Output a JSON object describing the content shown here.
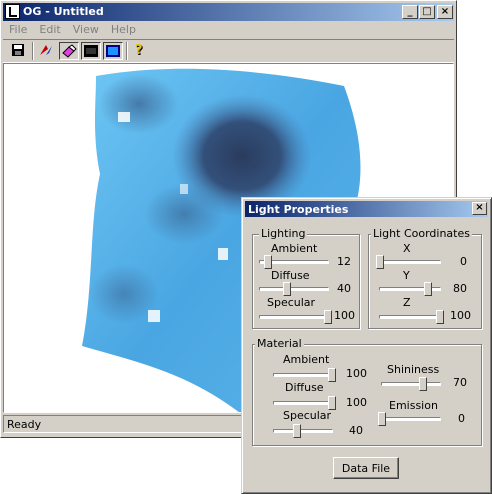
{
  "window": {
    "title": "OG - Untitled",
    "status": "Ready",
    "caption_buttons": {
      "minimize": "_",
      "maximize": "□",
      "close": "×"
    }
  },
  "menu": [
    "File",
    "Edit",
    "View",
    "Help"
  ],
  "toolbar": {
    "icons": [
      "save-icon",
      "light-icon",
      "eraser-icon",
      "black-rect-icon",
      "blue-rect-icon",
      "help-icon"
    ]
  },
  "colors": {
    "title_start": "#0a246a",
    "title_end": "#a6caf0",
    "surface_light": "#5ab4ea",
    "surface_dark": "#3d6a98",
    "surface_shadow": "#2a3c5e",
    "face": "#d4d0c8"
  },
  "dialog": {
    "title": "Light Properties",
    "close": "×",
    "lighting": {
      "label": "Lighting",
      "items": [
        {
          "label": "Ambient",
          "value": "12",
          "level": 0.12
        },
        {
          "label": "Diffuse",
          "value": "40",
          "level": 0.4
        },
        {
          "label": "Specular",
          "value": "100",
          "level": 1.0
        }
      ]
    },
    "coords": {
      "label": "Light Coordinates",
      "items": [
        {
          "label": "X",
          "value": "0",
          "level": 0.0
        },
        {
          "label": "Y",
          "value": "80",
          "level": 0.8
        },
        {
          "label": "Z",
          "value": "100",
          "level": 1.0
        }
      ]
    },
    "material": {
      "label": "Material",
      "left": [
        {
          "label": "Ambient",
          "value": "100",
          "level": 1.0
        },
        {
          "label": "Diffuse",
          "value": "100",
          "level": 1.0
        },
        {
          "label": "Specular",
          "value": "40",
          "level": 0.4
        }
      ],
      "right": [
        {
          "label": "Shininess",
          "value": "70",
          "level": 0.7
        },
        {
          "label": "Emission",
          "value": "0",
          "level": 0.0
        }
      ]
    },
    "button": "Data File"
  }
}
